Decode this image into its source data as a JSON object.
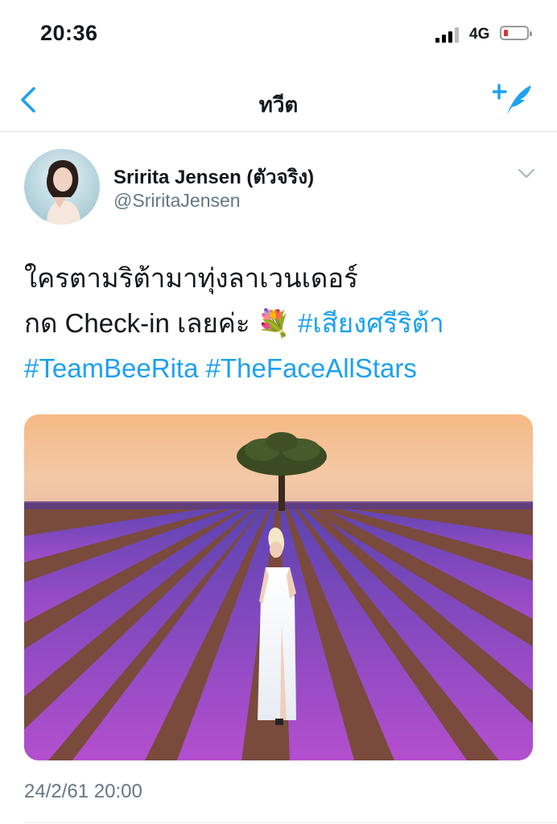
{
  "status_bar": {
    "time": "20:36",
    "network": "4G",
    "battery_color": "#e03131"
  },
  "nav": {
    "title": "ทวีต",
    "back_icon": "chevron-left-icon",
    "compose_icon": "compose-tweet-icon",
    "accent": "#1da1f2"
  },
  "tweet": {
    "display_name": "Sririta Jensen (ตัวจริง)",
    "handle": "@SriritaJensen",
    "text_line1": "ใครตามริต้ามาทุ่งลาเวนเดอร์",
    "text_line2_plain": "กด Check-in เลยค่ะ ",
    "text_emoji": "💐",
    "hashtags": [
      "#เสียงศรีริต้า",
      "#TeamBeeRita",
      "#TheFaceAllStars"
    ],
    "timestamp": "24/2/61 20:00",
    "caret_icon": "chevron-down-icon"
  }
}
